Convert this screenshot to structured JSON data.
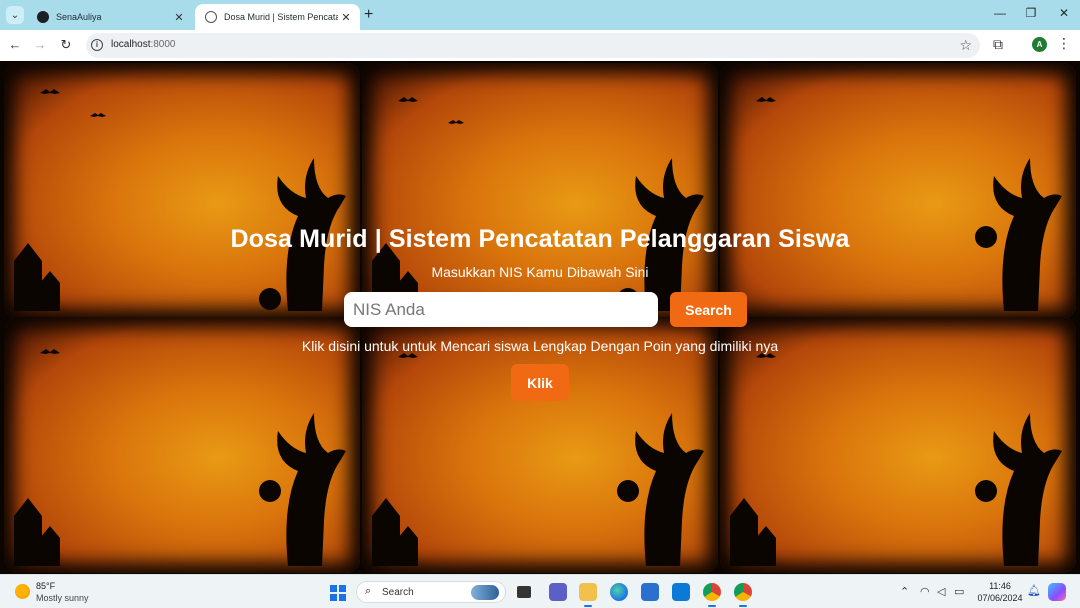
{
  "browser": {
    "tabs": [
      {
        "title": "SenaAuliya"
      },
      {
        "title": "Dosa Murid | Sistem Pencatatan"
      }
    ],
    "url_host": "localhost",
    "url_port": ":8000",
    "profile_initial": "A"
  },
  "page": {
    "title": "Dosa Murid | Sistem Pencatatan Pelanggaran Siswa",
    "subtitle": "Masukkan NIS Kamu Dibawah Sini",
    "nis_placeholder": "NIS Anda",
    "nis_value": "",
    "search_label": "Search",
    "hint": "Klik disini untuk untuk Mencari siswa Lengkap Dengan Poin yang dimiliki nya",
    "klik_label": "Klik",
    "background_colors": {
      "orange": "#e89a14",
      "dark": "#0b0502"
    },
    "accent_color": "#f16a13"
  },
  "taskbar": {
    "weather_temp": "85°F",
    "weather_condition": "Mostly sunny",
    "search_label": "Search",
    "time": "11:46",
    "date": "07/06/2024",
    "apps": [
      "task-view",
      "teams",
      "file-explorer",
      "edge",
      "microsoft-store",
      "vscode",
      "chrome-profile",
      "chrome"
    ]
  }
}
